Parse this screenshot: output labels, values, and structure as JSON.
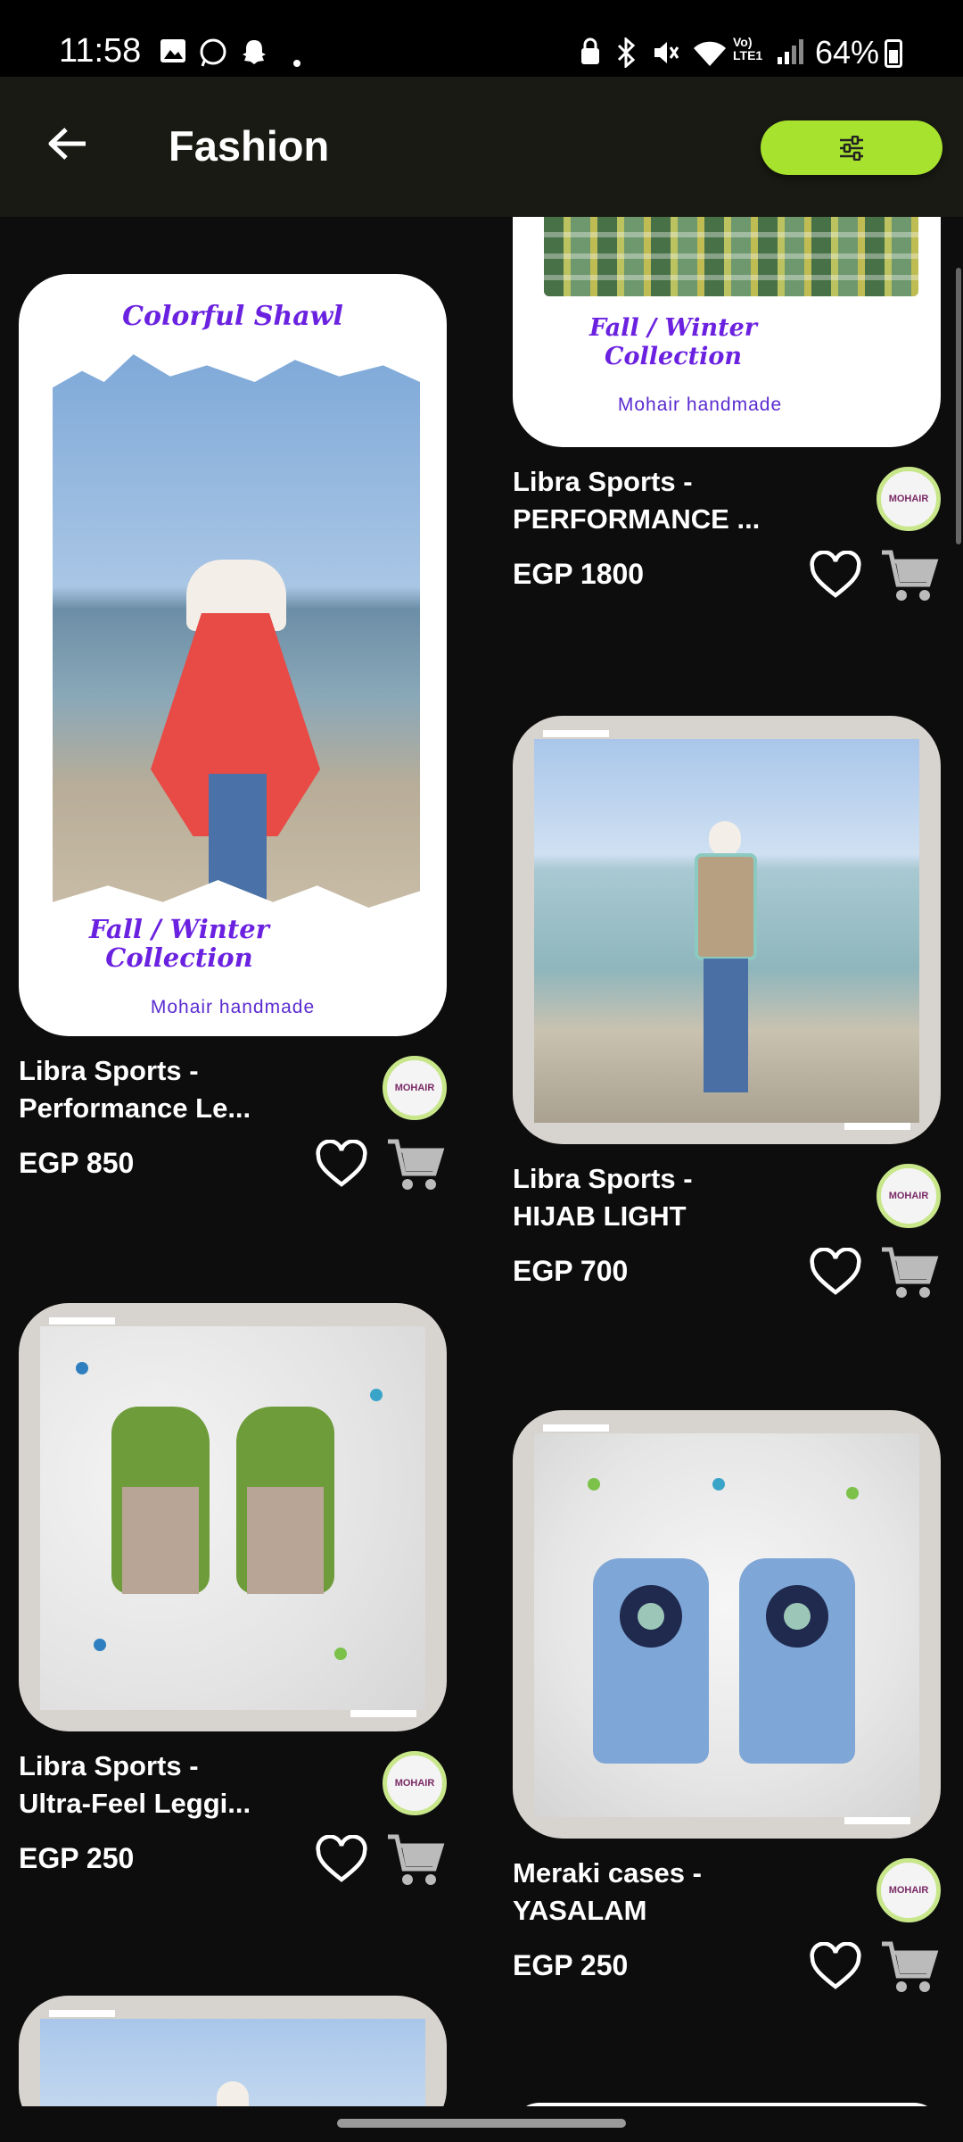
{
  "status_bar": {
    "time": "11:58",
    "battery": "64%",
    "icons": [
      "gallery-icon",
      "whatsapp-icon",
      "snapchat-icon",
      "dot-icon",
      "lock-icon",
      "bluetooth-icon",
      "mute-icon",
      "wifi-icon",
      "volte-icon",
      "signal-icon"
    ]
  },
  "header": {
    "title": "Fashion"
  },
  "colors": {
    "accent": "#a7e22e",
    "background": "#0d0d0d",
    "appbar": "#1a1a14"
  },
  "products": [
    {
      "title": "Libra Sports -\nPerformance Le...",
      "price": "EGP 850",
      "image_texts": {
        "top": "Colorful Shawl",
        "collection": "Fall / Winter\nCollection",
        "brand": "Mohair handmade"
      }
    },
    {
      "title": "Libra Sports -\nPERFORMANCE ...",
      "price": "EGP 1800",
      "image_texts": {
        "collection": "Fall / Winter\nCollection",
        "brand": "Mohair handmade"
      }
    },
    {
      "title": "Libra Sports -\nHIJAB LIGHT",
      "price": "EGP 700"
    },
    {
      "title": "Libra Sports -\nUltra-Feel Leggi...",
      "price": "EGP 250"
    },
    {
      "title": "Meraki cases  -\nYASALAM",
      "price": "EGP 250"
    }
  ],
  "seller_logo_text": "MOHAIR"
}
